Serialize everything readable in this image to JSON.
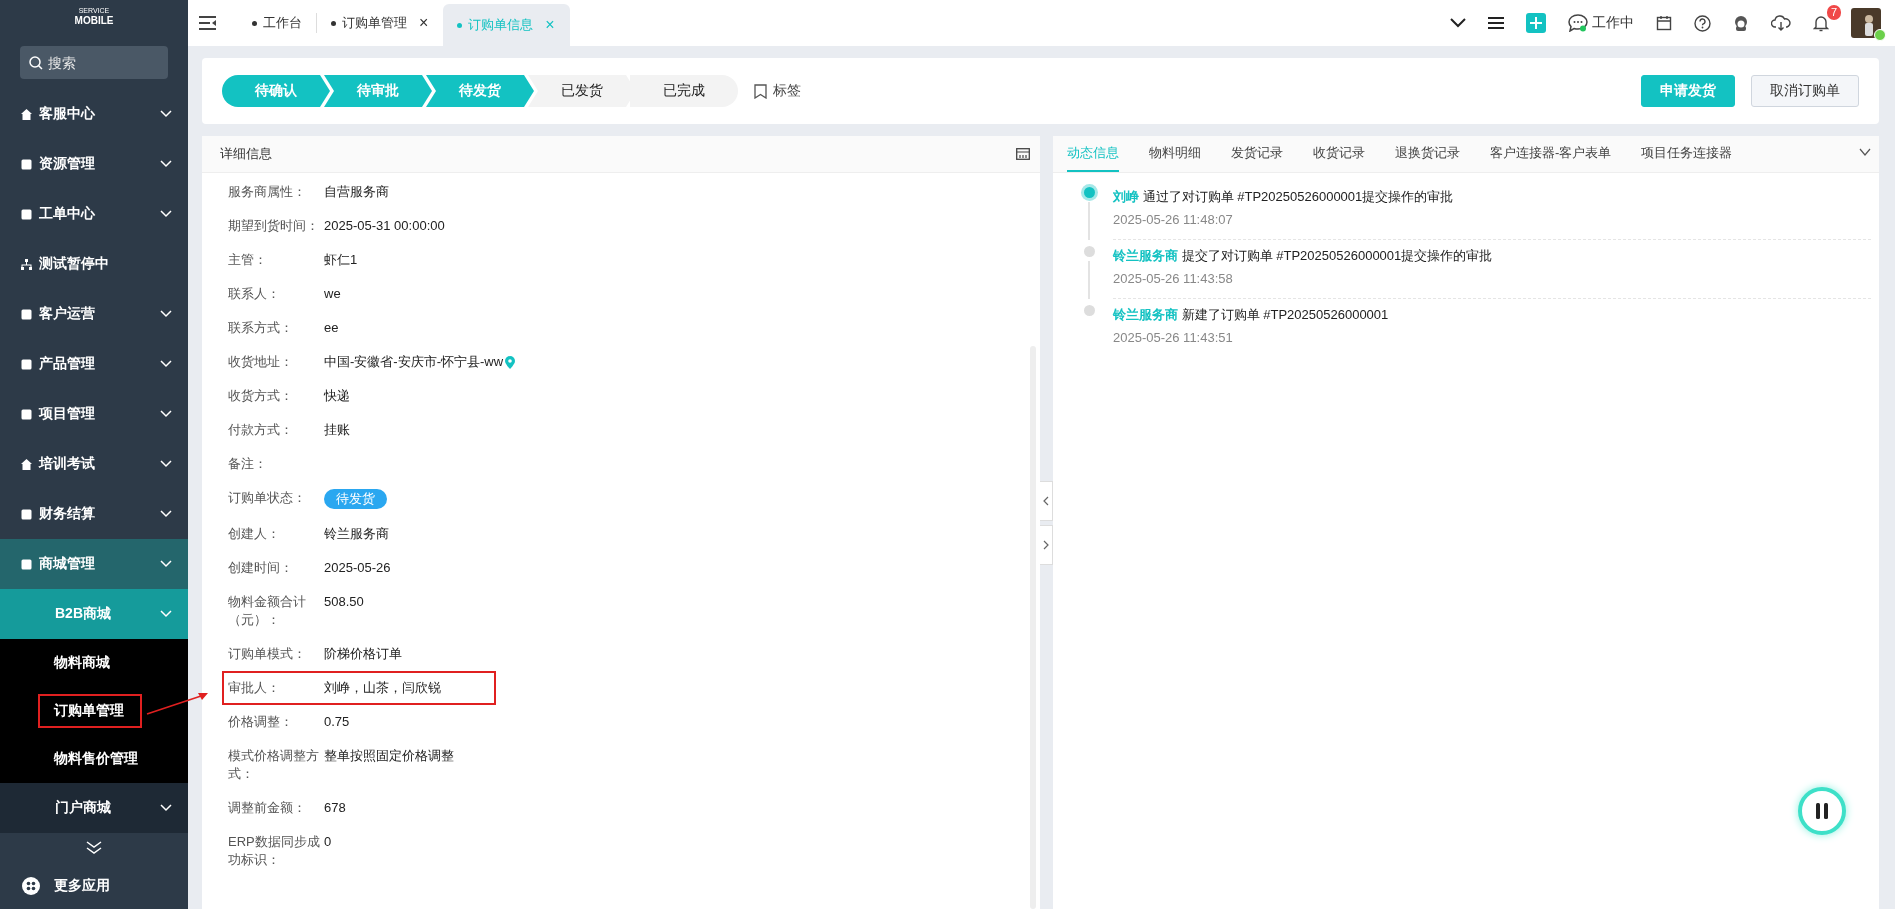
{
  "sidebar": {
    "logo": {
      "small": "SERVICE",
      "big": "MOBILE"
    },
    "search": {
      "placeholder": "搜索"
    },
    "items": [
      {
        "label": "客服中心",
        "kind": "group",
        "expanded": false
      },
      {
        "label": "资源管理",
        "kind": "group",
        "expanded": false
      },
      {
        "label": "工单中心",
        "kind": "group",
        "expanded": false
      },
      {
        "label": "测试暂停中",
        "kind": "link"
      },
      {
        "label": "客户运营",
        "kind": "group",
        "expanded": false
      },
      {
        "label": "产品管理",
        "kind": "group",
        "expanded": false
      },
      {
        "label": "项目管理",
        "kind": "group",
        "expanded": false
      },
      {
        "label": "培训考试",
        "kind": "group",
        "expanded": false
      },
      {
        "label": "财务结算",
        "kind": "group",
        "expanded": false
      },
      {
        "label": "商城管理",
        "kind": "group",
        "expanded": true,
        "children": [
          {
            "label": "B2B商城",
            "kind": "group",
            "expanded": true,
            "children": [
              {
                "label": "物料商城",
                "annotated": false
              },
              {
                "label": "订购单管理",
                "annotated": true
              },
              {
                "label": "物料售价管理",
                "annotated": false
              }
            ]
          },
          {
            "label": "门户商城",
            "kind": "group",
            "expanded": false
          }
        ]
      }
    ],
    "more": "更多应用"
  },
  "tabs": [
    {
      "label": "工作台",
      "selected": false
    },
    {
      "label": "订购单管理",
      "close": "×",
      "selected": false
    },
    {
      "label": "订购单信息",
      "close": "×",
      "selected": true
    }
  ],
  "header": {
    "status": "工作中",
    "notifications": "7"
  },
  "steps": [
    {
      "label": "待确认",
      "done": true
    },
    {
      "label": "待审批",
      "done": true
    },
    {
      "label": "待发货",
      "done": true
    },
    {
      "label": "已发货",
      "done": false
    },
    {
      "label": "已完成",
      "done": false
    }
  ],
  "tag_button": "标签",
  "actions": [
    {
      "label": "申请发货",
      "kind": "primary"
    },
    {
      "label": "取消订购单",
      "kind": "default"
    }
  ],
  "details": {
    "title": "详细信息",
    "rows": [
      {
        "label": "服务商属性：",
        "value": "自营服务商",
        "kind": "text",
        "annotated": false
      },
      {
        "label": "期望到货时间：",
        "value": "2025-05-31 00:00:00",
        "kind": "text",
        "annotated": false
      },
      {
        "label": "主管：",
        "value": "虾仁1",
        "kind": "text",
        "annotated": false
      },
      {
        "label": "联系人：",
        "value": "we",
        "kind": "text",
        "annotated": false
      },
      {
        "label": "联系方式：",
        "value": "ee",
        "kind": "text",
        "annotated": false
      },
      {
        "label": "收货地址：",
        "value": "中国-安徽省-安庆市-怀宁县-ww",
        "kind": "location",
        "annotated": false
      },
      {
        "label": "收货方式：",
        "value": "快递",
        "kind": "text",
        "annotated": false
      },
      {
        "label": "付款方式：",
        "value": "挂账",
        "kind": "text",
        "annotated": false
      },
      {
        "label": "备注：",
        "kind": "text",
        "annotated": false
      },
      {
        "label": "订购单状态：",
        "value": "待发货",
        "kind": "badge",
        "annotated": false
      },
      {
        "label": "创建人：",
        "value": "铃兰服务商",
        "kind": "text",
        "annotated": false
      },
      {
        "label": "创建时间：",
        "value": "2025-05-26",
        "kind": "text",
        "annotated": false
      },
      {
        "label": "物料金额合计（元）：",
        "value": "508.50",
        "kind": "text",
        "annotated": false
      },
      {
        "label": "订购单模式：",
        "value": "阶梯价格订单",
        "kind": "text",
        "annotated": false
      },
      {
        "label": "审批人：",
        "value": "刘峥，山茶，闫欣锐",
        "kind": "text",
        "annotated": true
      },
      {
        "label": "价格调整：",
        "value": "0.75",
        "kind": "text",
        "annotated": false
      },
      {
        "label": "模式价格调整方式：",
        "value": "整单按照固定价格调整",
        "kind": "text",
        "annotated": false
      },
      {
        "label": "调整前金额：",
        "value": "678",
        "kind": "text",
        "annotated": false
      },
      {
        "label": "ERP数据同步成功标识：",
        "value": "0",
        "kind": "text",
        "annotated": false
      }
    ]
  },
  "activity": {
    "tabs": [
      {
        "label": "动态信息",
        "selected": true
      },
      {
        "label": "物料明细",
        "selected": false
      },
      {
        "label": "发货记录",
        "selected": false
      },
      {
        "label": "收货记录",
        "selected": false
      },
      {
        "label": "退换货记录",
        "selected": false
      },
      {
        "label": "客户连接器-客户表单",
        "selected": false
      },
      {
        "label": "项目任务连接器",
        "selected": false
      }
    ],
    "entries": [
      {
        "actor": "刘峥",
        "text": "通过了对订购单 #TP20250526000001提交操作的审批",
        "time": "2025-05-26 11:48:07",
        "current": true
      },
      {
        "actor": "铃兰服务商",
        "text": "提交了对订购单 #TP20250526000001提交操作的审批",
        "time": "2025-05-26 11:43:58",
        "current": false
      },
      {
        "actor": "铃兰服务商",
        "text": "新建了订购单 #TP20250526000001",
        "time": "2025-05-26 11:43:51",
        "current": false
      }
    ]
  }
}
